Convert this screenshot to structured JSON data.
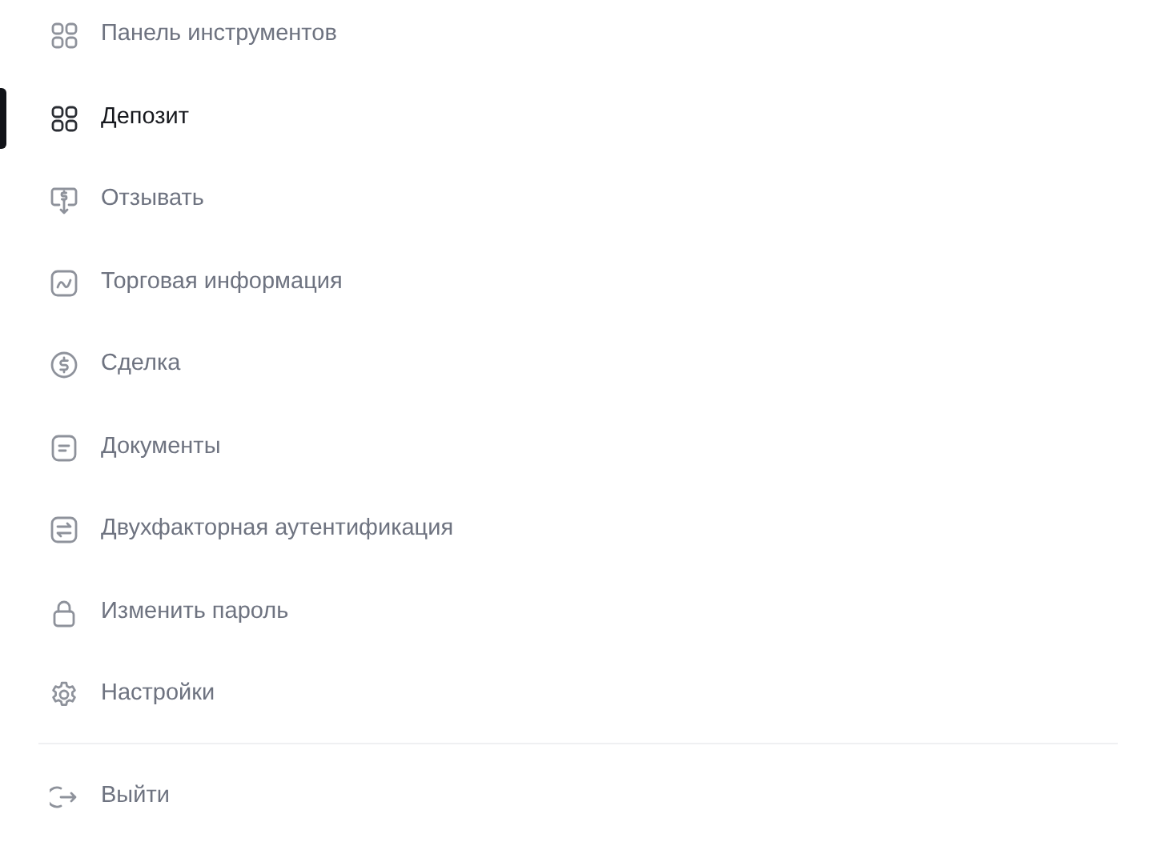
{
  "menu": [
    {
      "label": "Панель инструментов",
      "selected": false
    },
    {
      "label": "Депозит",
      "selected": true
    },
    {
      "label": "Отзывать",
      "selected": false
    },
    {
      "label": "Торговая информация",
      "selected": false
    },
    {
      "label": "Сделка",
      "selected": false
    },
    {
      "label": "Документы",
      "selected": false
    },
    {
      "label": "Двухфакторная аутентификация",
      "selected": false
    },
    {
      "label": "Изменить пароль",
      "selected": false
    },
    {
      "label": "Настройки",
      "selected": false
    }
  ],
  "logout": {
    "label": "Выйти"
  }
}
